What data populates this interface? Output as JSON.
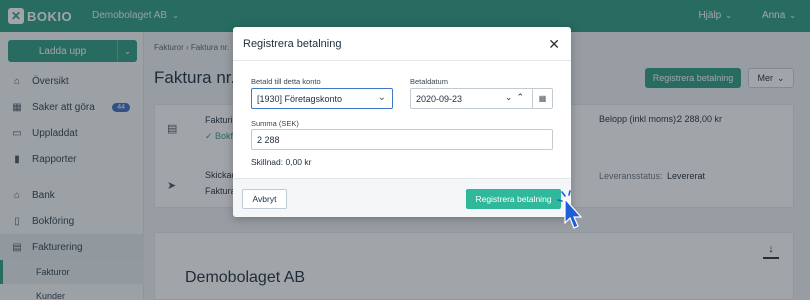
{
  "topbar": {
    "logo_text": "BOKIO",
    "company": "Demobolaget AB",
    "help": "Hjälp",
    "user": "Anna"
  },
  "sidebar": {
    "upload_label": "Ladda upp",
    "items": [
      {
        "label": "Översikt",
        "icon": "home-icon"
      },
      {
        "label": "Saker att göra",
        "icon": "calendar-icon",
        "badge": "44"
      },
      {
        "label": "Uppladdat",
        "icon": "folder-icon"
      },
      {
        "label": "Rapporter",
        "icon": "bar-chart-icon"
      },
      {
        "label": "Bank",
        "icon": "bank-icon"
      },
      {
        "label": "Bokföring",
        "icon": "book-icon"
      },
      {
        "label": "Fakturering",
        "icon": "invoice-icon"
      }
    ],
    "sub_items": [
      {
        "label": "Fakturor"
      },
      {
        "label": "Kunder"
      }
    ]
  },
  "main": {
    "breadcrumb": "Fakturor  ›  Faktura nr.",
    "title": "Faktura nr.",
    "register_button": "Registrera betalning",
    "more_button": "Mer",
    "card1": {
      "row1_title": "Fakturi",
      "row1_status": "✓ Bokfö",
      "amount_label": "Belopp (inkl moms):",
      "amount_value": "2 288,00 kr",
      "row2_title": "Skickad",
      "row2_sub": "Faktura",
      "delivery_label": "Leveransstatus:",
      "delivery_value": "Levererat"
    },
    "document_company": "Demobolaget AB"
  },
  "modal": {
    "title": "Registrera betalning",
    "account_label": "Betald till detta konto",
    "account_value": "[1930] Företagskonto",
    "date_label": "Betaldatum",
    "date_value": "2020-09-23",
    "sum_label": "Summa (SEK)",
    "sum_value": "2 288",
    "difference_text": "Skillnad: 0,00 kr",
    "cancel_label": "Avbryt",
    "confirm_label": "Registrera betalning"
  },
  "colors": {
    "brand": "#2f9b83",
    "confirm": "#2fb89a",
    "badge": "#3f6ec3",
    "focus": "#3f78c8",
    "cursor": "#1e5fd8"
  }
}
